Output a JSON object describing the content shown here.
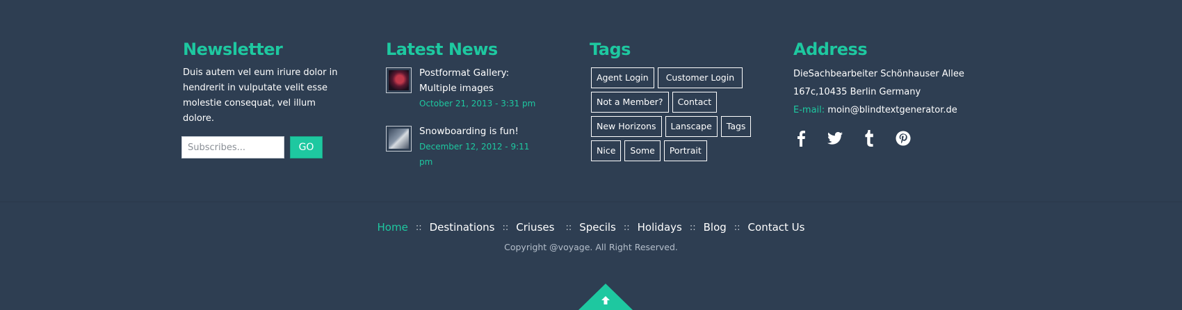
{
  "newsletter": {
    "title": "Newsletter",
    "description": "Duis autem vel eum iriure dolor in hendrerit in vulputate velit esse molestie consequat, vel illum dolore.",
    "input_placeholder": "Subscribes...",
    "go_label": "GO"
  },
  "news": {
    "title": "Latest News",
    "items": [
      {
        "title": "Postformat Gallery: Multiple images",
        "date": "October 21, 2013 - 3:31 pm"
      },
      {
        "title": "Snowboarding is fun!",
        "date": "December 12, 2012 - 9:11 pm"
      }
    ]
  },
  "tags": {
    "title": "Tags",
    "items": [
      "Agent Login",
      "Customer Login",
      "Not a Member?",
      "Contact",
      "New Horizons",
      "Lanscape",
      "Tags",
      "Nice",
      "Some",
      "Portrait"
    ]
  },
  "address": {
    "title": "Address",
    "line1": "DieSachbearbeiter Schönhauser Allee",
    "line2": "167c,10435 Berlin Germany",
    "email_label": "E-mail:",
    "email": "moin@blindtextgenerator.de",
    "social_icons": [
      "facebook-icon",
      "twitter-icon",
      "tumblr-icon",
      "pinterest-icon"
    ]
  },
  "bottom_nav": {
    "items": [
      "Home",
      "Destinations",
      "Criuses",
      "Specils",
      "Holidays",
      "Blog",
      "Contact Us"
    ],
    "separator": "::"
  },
  "copyright": "Copyright @voyage. All Right Reserved.",
  "colors": {
    "background": "#2e3e52",
    "accent": "#1ec8a0"
  }
}
